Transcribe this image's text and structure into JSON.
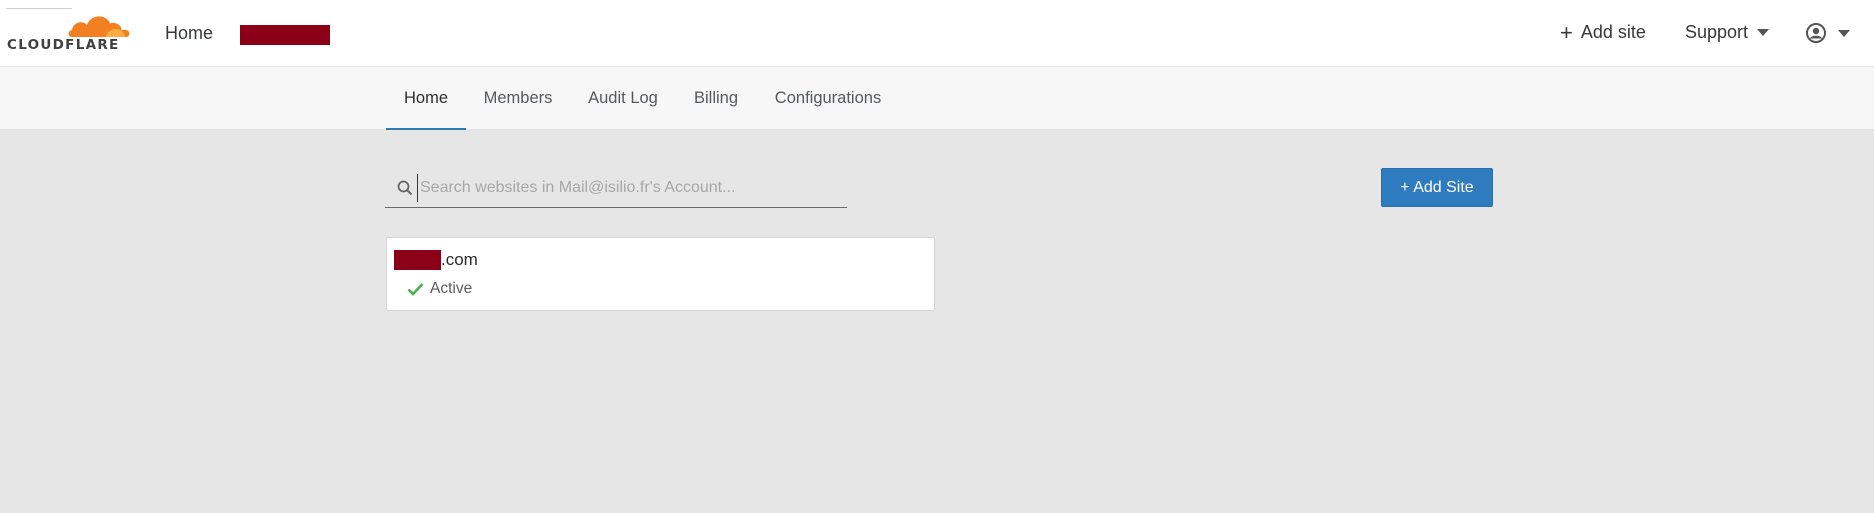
{
  "header": {
    "logo_text": "CLOUDFLARE",
    "home_label": "Home",
    "account_name": "[redacted]",
    "add_site_label": "Add site",
    "support_label": "Support",
    "user_icon": "user-circle-icon"
  },
  "tabs": [
    {
      "label": "Home",
      "active": true
    },
    {
      "label": "Members",
      "active": false
    },
    {
      "label": "Audit Log",
      "active": false
    },
    {
      "label": "Billing",
      "active": false
    },
    {
      "label": "Configurations",
      "active": false
    }
  ],
  "search": {
    "placeholder": "Search websites in Mail@isilio.fr's Account...",
    "value": ""
  },
  "add_site_button": "+ Add Site",
  "sites": [
    {
      "domain_suffix": ".com",
      "status": "Active"
    }
  ],
  "colors": {
    "accent": "#2f7bbf",
    "brand_orange": "#f38020",
    "status_active": "#4caf50",
    "redaction": "#8b0017"
  }
}
